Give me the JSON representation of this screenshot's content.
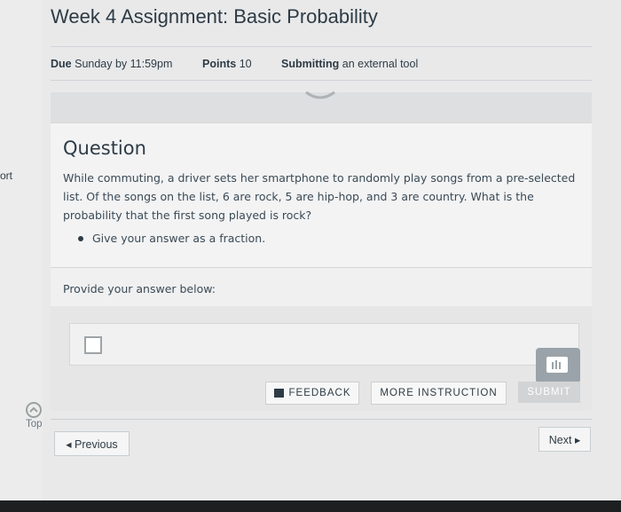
{
  "assignment": {
    "title": "Week 4 Assignment: Basic Probability",
    "due_label": "Due",
    "due_value": "Sunday by 11:59pm",
    "points_label": "Points",
    "points_value": "10",
    "submitting_label": "Submitting",
    "submitting_value": "an external tool"
  },
  "sidebar": {
    "fragment": "ort",
    "top_label": "Top"
  },
  "question": {
    "heading": "Question",
    "text": "While commuting, a driver sets her smartphone to randomly play songs from a pre-selected list. Of the songs on the list, 6 are rock, 5 are hip-hop, and 3 are country. What is the probability that the first song played is rock?",
    "bullet": "Give your answer as a fraction."
  },
  "answer": {
    "label": "Provide your answer below:"
  },
  "buttons": {
    "feedback": "FEEDBACK",
    "more_instruction": "MORE INSTRUCTION",
    "submit": "SUBMIT",
    "previous": "◂ Previous",
    "next": "Next ▸"
  }
}
